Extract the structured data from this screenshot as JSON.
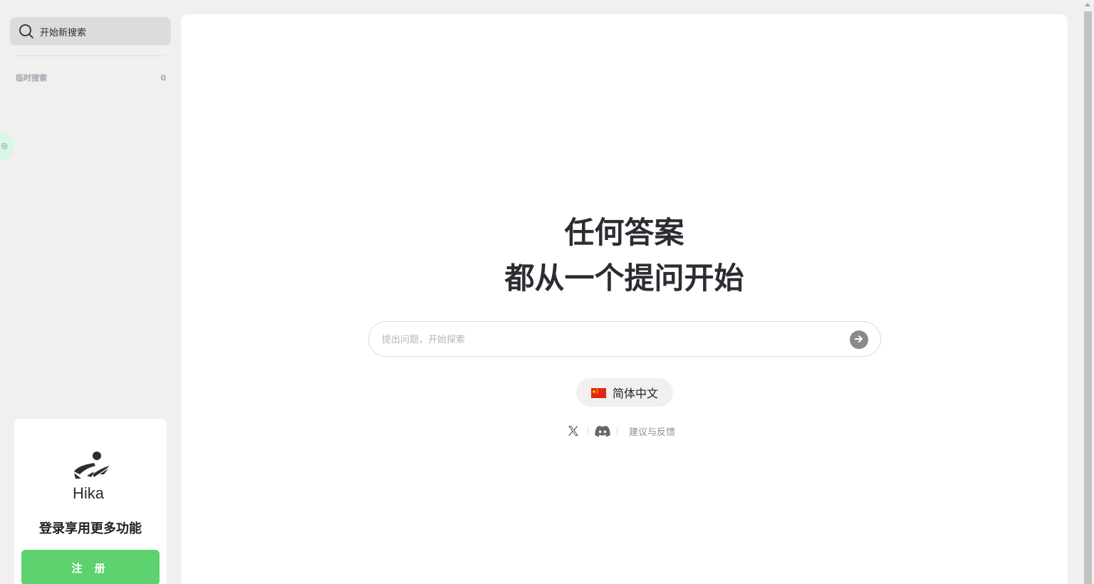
{
  "sidebar": {
    "new_search_label": "开始新搜索",
    "recent_label": "临时搜索",
    "recent_count": "0",
    "login_card": {
      "brand": "Hika",
      "tip": "登录享用更多功能",
      "signup_label": "注 册"
    }
  },
  "main": {
    "hero_line1": "任何答案",
    "hero_line2": "都从一个提问开始",
    "ask": {
      "placeholder": "提出问题，开始探索",
      "value": ""
    },
    "language": {
      "label": "简体中文"
    },
    "footer": {
      "feedback_label": "建议与反馈"
    }
  },
  "colors": {
    "background": "#f1f0ee",
    "panel": "#ffffff",
    "accent_green": "#5dd26f",
    "text_dark": "#2b2d33",
    "muted": "#a3a5ad"
  },
  "icons": {
    "search": "search-icon",
    "submit": "arrow-right-icon",
    "flag": "china-flag-icon",
    "x": "x-logo-icon",
    "discord": "discord-icon",
    "logo": "hika-logo-icon"
  }
}
